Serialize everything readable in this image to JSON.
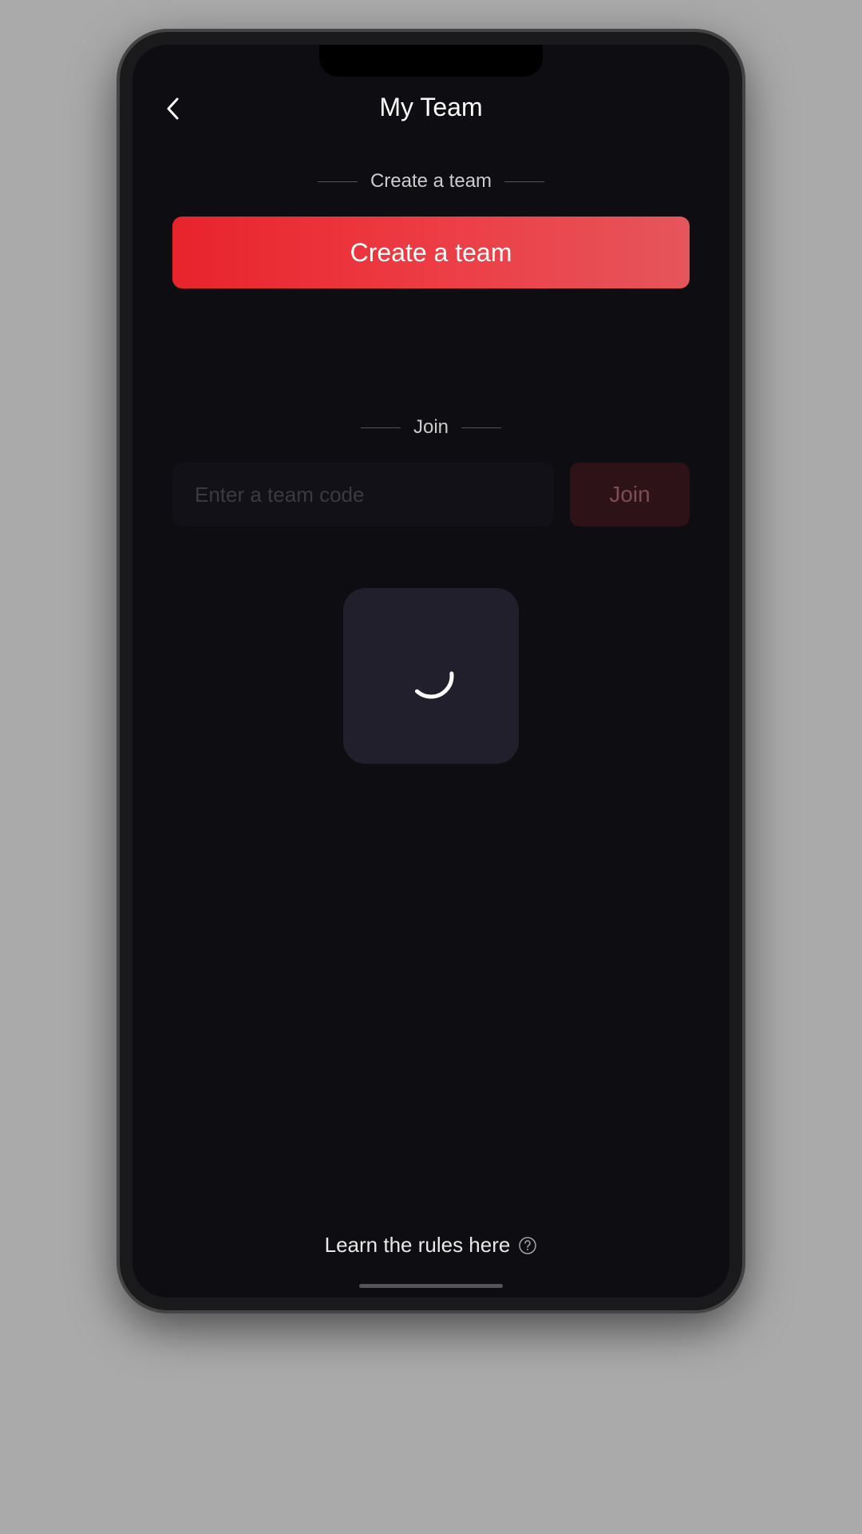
{
  "header": {
    "title": "My Team"
  },
  "sections": {
    "create": {
      "label": "Create a team",
      "button_label": "Create a team"
    },
    "join": {
      "label": "Join",
      "input_placeholder": "Enter a team code",
      "button_label": "Join"
    }
  },
  "footer": {
    "rules_text": "Learn the rules here"
  }
}
